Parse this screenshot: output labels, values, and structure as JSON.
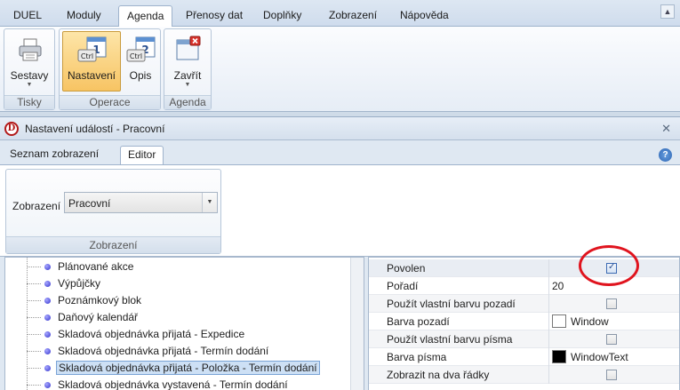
{
  "menu": {
    "tabs": [
      "DUEL",
      "Moduly",
      "Agenda",
      "Přenosy dat",
      "Doplňky",
      "Zobrazení",
      "Nápověda"
    ],
    "active_tab": "Agenda"
  },
  "ribbon": {
    "tisky": {
      "label": "Tisky",
      "sestavy": "Sestavy"
    },
    "operace": {
      "label": "Operace",
      "nastaveni": "Nastavení",
      "opis": "Opis",
      "ctrl1": "Ctrl",
      "ctrl2": "Ctrl",
      "num1": "1",
      "num2": "2"
    },
    "agenda": {
      "label": "Agenda",
      "zavrit": "Zavřít"
    }
  },
  "dialog": {
    "title": "Nastavení událostí - Pracovní",
    "logo": "D",
    "tabs": [
      "Seznam zobrazení",
      "Editor"
    ],
    "active_tab": "Editor",
    "help": "?",
    "zobrazeni": {
      "field_label": "Zobrazení",
      "value": "Pracovní",
      "group_label": "Zobrazení"
    }
  },
  "tree": {
    "items": [
      "Plánované akce",
      "Výpůjčky",
      "Poznámkový blok",
      "Daňový kalendář",
      "Skladová objednávka přijatá - Expedice",
      "Skladová objednávka přijatá - Termín dodání",
      "Skladová objednávka přijatá - Položka - Termín dodání",
      "Skladová objednávka vystavená - Termín dodání"
    ],
    "selected_index": 6
  },
  "properties": {
    "rows": [
      {
        "name": "Povolen",
        "type": "checkbox",
        "checked": true
      },
      {
        "name": "Pořadí",
        "type": "text",
        "value": "20"
      },
      {
        "name": "Použít vlastní barvu pozadí",
        "type": "checkbox",
        "checked": false
      },
      {
        "name": "Barva pozadí",
        "type": "color",
        "value": "Window",
        "color": "#ffffff"
      },
      {
        "name": "Použít vlastní barvu písma",
        "type": "checkbox",
        "checked": false
      },
      {
        "name": "Barva písma",
        "type": "color",
        "value": "WindowText",
        "color": "#000000"
      },
      {
        "name": "Zobrazit na dva řádky",
        "type": "checkbox",
        "checked": false
      }
    ]
  },
  "colors": {
    "accent_selected": "#f7c463",
    "annotation": "#e0141e"
  }
}
